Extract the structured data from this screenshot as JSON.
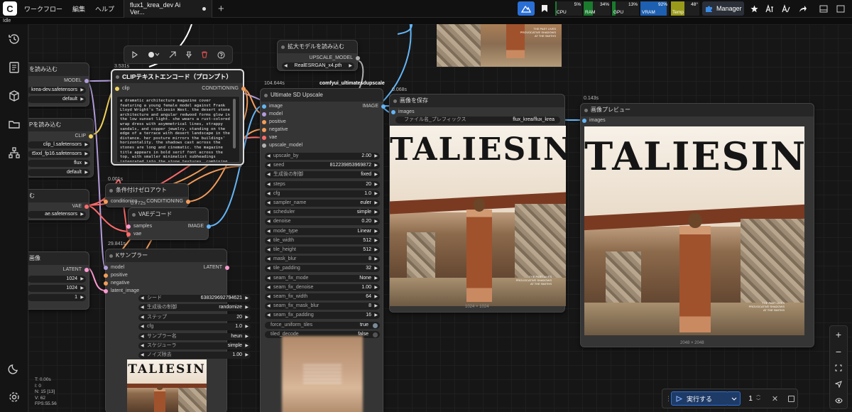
{
  "menu": {
    "workflow": "ワークフロー",
    "edit": "編集",
    "help": "ヘルプ"
  },
  "tab": {
    "title": "flux1_krea_dev Ai Ver..."
  },
  "status": {
    "text": "Idle"
  },
  "monitor": {
    "cpu": {
      "label": "CPU",
      "value": "5%",
      "pct": 5
    },
    "ram": {
      "label": "RAM",
      "value": "34%",
      "pct": 34
    },
    "gpu": {
      "label": "GPU",
      "value": "13%",
      "pct": 13
    },
    "vram": {
      "label": "VRAM",
      "value": "92%",
      "pct": 92
    },
    "temp": {
      "label": "Temp",
      "value": "48°",
      "pct": 48
    }
  },
  "manager_label": "Manager",
  "colors": {
    "accent": "#2a6fd6",
    "run_button": "#1e3a66",
    "cpu_bar": "#1a7a2e",
    "vram_bar": "#1d5fb0",
    "temp_bar": "#9a9a1a"
  },
  "nodes": {
    "load_model": {
      "title": "を読み込む",
      "output_model": "MODEL",
      "file": "krea-dev.safetensors",
      "weight": "default"
    },
    "dual_clip": {
      "title": "Pを読み込む",
      "output_clip": "CLIP",
      "file1": "clip_l.safetensors",
      "file2": "t5xxl_fp16.safetensors",
      "type": "flux",
      "device": "default"
    },
    "vae_loader": {
      "title": "む",
      "output_vae": "VAE",
      "file": "ae.safetensors"
    },
    "latent": {
      "title": "画像",
      "output_latent": "LATENT",
      "width": "1024",
      "height": "1024",
      "batch": "1"
    },
    "clip_encode": {
      "timing": "3.531s",
      "title": "CLIPテキストエンコード（プロンプト）",
      "input_clip": "clip",
      "output_conditioning": "CONDITIONING",
      "prompt": "a dramatic architecture magazine cover featuring a young female model against Frank Lloyd Wright's Taliesin West. the desert stone architecture and angular redwood forms glow in the low sunset light. she wears a rust-colored wrap dress with asymmetrical lines, strappy sandals, and copper jewelry, standing on the edge of a terrace with desert landscape in the distance. her posture mirrors the buildings' horizontality. the shadows cast across the stones are long and cinematic. the magazine title appears in bold serif font across the top, with smaller minimalist subheadings integrated into the stone textures, combining fashion, history, and desert modernism in photorealistic editorial depth"
    },
    "cond_zero": {
      "timing": "0.001s",
      "title": "条件付けゼロアウト",
      "input": "conditioning",
      "output": "CONDITIONING"
    },
    "vae_decode": {
      "timing": "0.772s",
      "title": "VAEデコード",
      "input_samples": "samples",
      "input_vae": "vae",
      "output_image": "IMAGE"
    },
    "ksampler": {
      "timing": "29.841s",
      "title": "Kサンプラー",
      "inputs": [
        "model",
        "positive",
        "negative",
        "latent_image"
      ],
      "output": "LATENT",
      "widgets": [
        {
          "name": "シード",
          "value": "638329692794621"
        },
        {
          "name": "生成後の制御",
          "value": "randomize"
        },
        {
          "name": "ステップ",
          "value": "20"
        },
        {
          "name": "cfg",
          "value": "1.0"
        },
        {
          "name": "サンプラー名",
          "value": "heun"
        },
        {
          "name": "スケジューラ",
          "value": "simple"
        },
        {
          "name": "ノイズ除去",
          "value": "1.00"
        }
      ]
    },
    "upscale_loader": {
      "title": "拡大モデルを読み込む",
      "output": "UPSCALE_MODEL",
      "file": "RealESRGAN_x4.pth",
      "badge": "comfyui_ultimatesdupscale"
    },
    "ultimate_sd": {
      "timing": "104.644s",
      "title": "Ultimate SD Upscale",
      "inputs": [
        "image",
        "model",
        "positive",
        "negative",
        "vae",
        "upscale_model"
      ],
      "output": "IMAGE",
      "widgets": [
        {
          "name": "upscale_by",
          "value": "2.00"
        },
        {
          "name": "seed",
          "value": "812239853969872"
        },
        {
          "name": "生成後の制御",
          "value": "fixed"
        },
        {
          "name": "steps",
          "value": "20"
        },
        {
          "name": "cfg",
          "value": "1.0"
        },
        {
          "name": "sampler_name",
          "value": "euler"
        },
        {
          "name": "scheduler",
          "value": "simple"
        },
        {
          "name": "denoise",
          "value": "0.20"
        },
        {
          "name": "mode_type",
          "value": "Linear"
        },
        {
          "name": "tile_width",
          "value": "512"
        },
        {
          "name": "tile_height",
          "value": "512"
        },
        {
          "name": "mask_blur",
          "value": "8"
        },
        {
          "name": "tile_padding",
          "value": "32"
        },
        {
          "name": "seam_fix_mode",
          "value": "None"
        },
        {
          "name": "seam_fix_denoise",
          "value": "1.00"
        },
        {
          "name": "seam_fix_width",
          "value": "64"
        },
        {
          "name": "seam_fix_mask_blur",
          "value": "8"
        },
        {
          "name": "seam_fix_padding",
          "value": "16"
        }
      ],
      "toggles": [
        {
          "name": "force_uniform_tiles",
          "value": "true"
        },
        {
          "name": "tiled_decode",
          "value": "false"
        }
      ]
    },
    "save_image": {
      "timing": "0.068s",
      "title": "画像を保存",
      "input": "images",
      "prefix_label": "ファイル名_プレフィックス",
      "prefix_value": "flux_krea/flux_krea",
      "dims": "1024 × 1024"
    },
    "preview_image": {
      "timing": "0.143s",
      "title": "画像プレビュー",
      "input": "images",
      "dims": "2048 × 2048"
    }
  },
  "poster": {
    "title": "TALIESIN",
    "caption": "THE PAST LIVES\nPROVOCATIVE SHADOWS\nAT THE SMITHS"
  },
  "stats": {
    "t": "T: 0.00s",
    "i": "I: 0",
    "n": "N: 15 [13]",
    "v": "V: 62",
    "fps": "FPS:55.56"
  },
  "run": {
    "label": "実行する",
    "count": "1"
  }
}
